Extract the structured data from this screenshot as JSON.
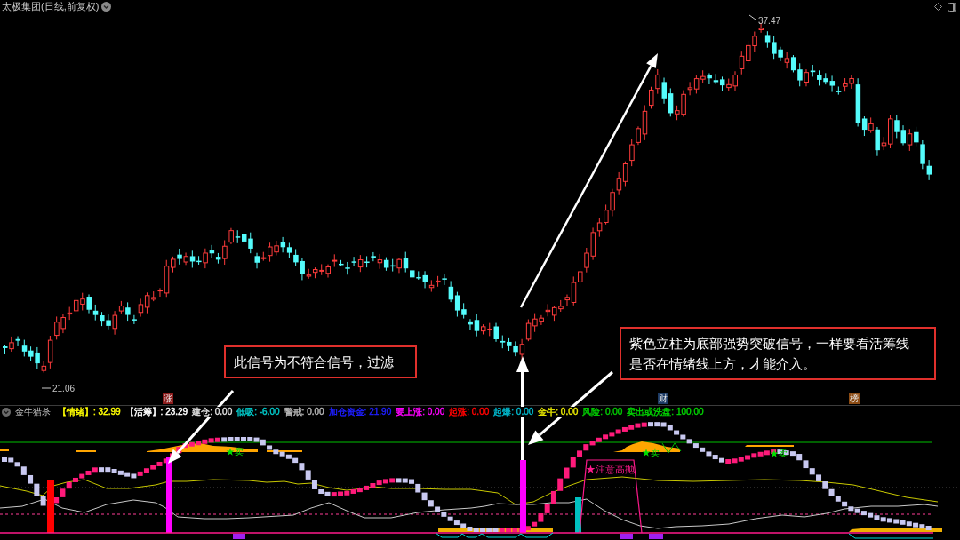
{
  "window": {
    "title": "太极集团(日线,前复权)"
  },
  "price_chart": {
    "high_label": "37.47",
    "low_label": "21.06"
  },
  "annotations": [
    {
      "lines": [
        "此信号为不符合信号，过滤"
      ]
    },
    {
      "lines": [
        "紫色立柱为底部强势突破信号，一样要看活筹线",
        "是否在情绪线上方，才能介入。"
      ]
    }
  ],
  "event_markers": [
    {
      "text": "涨",
      "color": "#8c1c1c"
    },
    {
      "text": "财",
      "color": "#1c3a64"
    },
    {
      "text": "榜",
      "color": "#8c4c14"
    }
  ],
  "indicator": {
    "name": "金牛猎杀",
    "legend": [
      {
        "text": "【情绪】: 32.99",
        "color": "#ffff00"
      },
      {
        "text": "【活筹】: 23.29",
        "color": "#ffffff"
      },
      {
        "text": "建仓: 0.00",
        "color": "#dcdcdc"
      },
      {
        "text": "低吸: -6.00",
        "color": "#00c8c8"
      },
      {
        "text": "警戒: 0.00",
        "color": "#b4b4b4"
      },
      {
        "text": "加仓资金: 21.90",
        "color": "#1e1eff"
      },
      {
        "text": "要上涨: 0.00",
        "color": "#ff00ff"
      },
      {
        "text": "起涨: 0.00",
        "color": "#ff0000"
      },
      {
        "text": "起爆: 0.00",
        "color": "#00b4c8"
      },
      {
        "text": "金牛: 0.00",
        "color": "#e6e600"
      },
      {
        "text": "风险: 0.00",
        "color": "#00c800"
      },
      {
        "text": "卖出或洗盘: 100.00",
        "color": "#00d200"
      }
    ],
    "sell_labels": [
      {
        "text": "★卖"
      },
      {
        "text": "★卖"
      },
      {
        "text": "★卖"
      }
    ],
    "alert_label": "★注意高抛"
  }
}
